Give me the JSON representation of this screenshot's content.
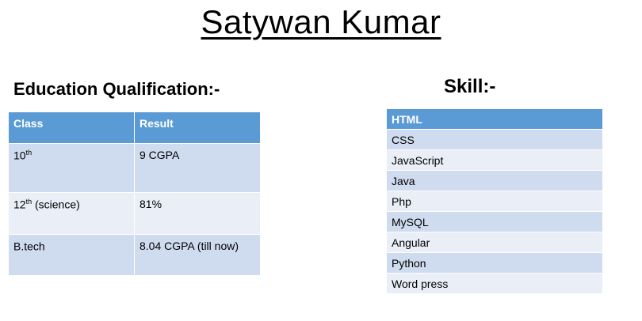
{
  "title": "Satywan Kumar",
  "education": {
    "heading": "Education Qualification:-",
    "headers": [
      "Class",
      "Result"
    ],
    "rows": [
      {
        "class": "10",
        "sup": "th",
        "suffix": "",
        "result": "9 CGPA"
      },
      {
        "class": "12",
        "sup": "th",
        "suffix": " (science)",
        "result": "81%"
      },
      {
        "class": "B.tech",
        "sup": "",
        "suffix": "",
        "result": "8.04 CGPA (till now)"
      }
    ]
  },
  "skills": {
    "heading": "Skill:-",
    "header": "HTML",
    "items": [
      "CSS",
      "JavaScript",
      "Java",
      "Php",
      "MySQL",
      "Angular",
      "Python",
      "Word press"
    ]
  },
  "colors": {
    "header": "#5b9bd5",
    "row_dark": "#cfdbee",
    "row_light": "#e9eef7"
  }
}
